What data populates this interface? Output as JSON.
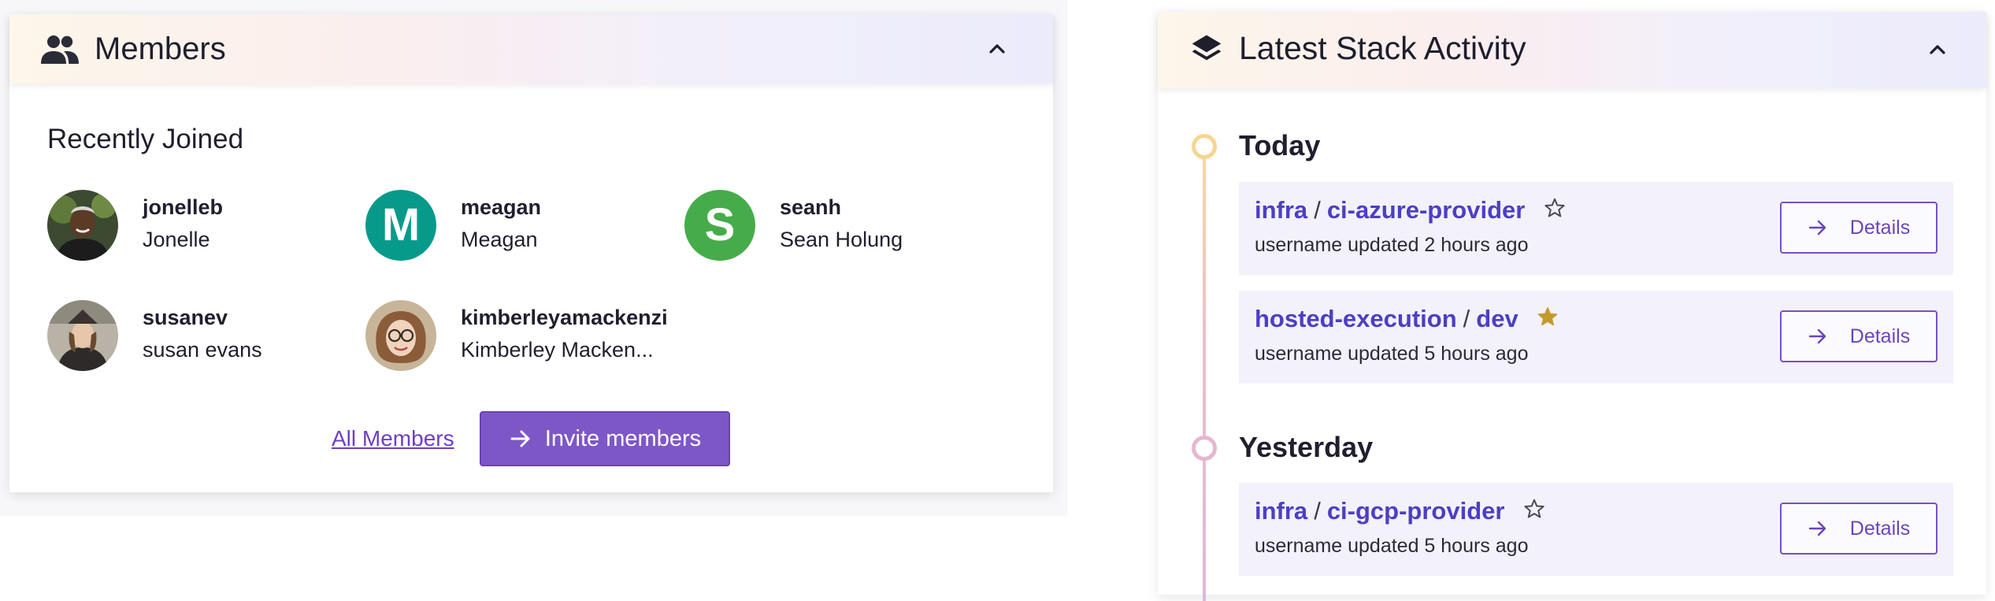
{
  "members": {
    "title": "Members",
    "section_title": "Recently Joined",
    "list": [
      {
        "username": "jonelleb",
        "name": "Jonelle",
        "avatar": "photo"
      },
      {
        "username": "meagan",
        "name": "Meagan",
        "avatar": "letter",
        "initial": "M",
        "color": "#079a8a"
      },
      {
        "username": "seanh",
        "name": "Sean Holung",
        "avatar": "letter",
        "initial": "S",
        "color": "#46ac4a"
      },
      {
        "username": "susanev",
        "name": "susan evans",
        "avatar": "photo"
      },
      {
        "username": "kimberleyamackenzi",
        "name": "Kimberley Macken...",
        "avatar": "photo"
      }
    ],
    "all_members_label": "All Members",
    "invite_label": "Invite members"
  },
  "activity": {
    "title": "Latest Stack Activity",
    "groups": [
      {
        "label": "Today",
        "dot_color": "#f7d691",
        "items": [
          {
            "org": "infra",
            "stack": "ci-azure-provider",
            "starred": false,
            "updated": "username updated 2 hours ago",
            "button": "Details"
          },
          {
            "org": "hosted-execution",
            "stack": "dev",
            "starred": true,
            "updated": "username updated 5 hours ago",
            "button": "Details"
          }
        ]
      },
      {
        "label": "Yesterday",
        "dot_color": "#e5b7d0",
        "items": [
          {
            "org": "infra",
            "stack": "ci-gcp-provider",
            "starred": false,
            "updated": "username updated 5 hours ago",
            "button": "Details"
          }
        ]
      }
    ]
  },
  "icons": {
    "members_header": "people-icon",
    "activity_header": "layers-icon",
    "collapse": "chevron-up-icon",
    "arrow": "arrow-right-icon",
    "star_outline": "star-outline-icon",
    "star_filled": "star-filled-icon"
  },
  "colors": {
    "accent_purple": "#7e57c7",
    "link_purple": "#4b3fc4",
    "star_gold": "#c49a2c"
  }
}
